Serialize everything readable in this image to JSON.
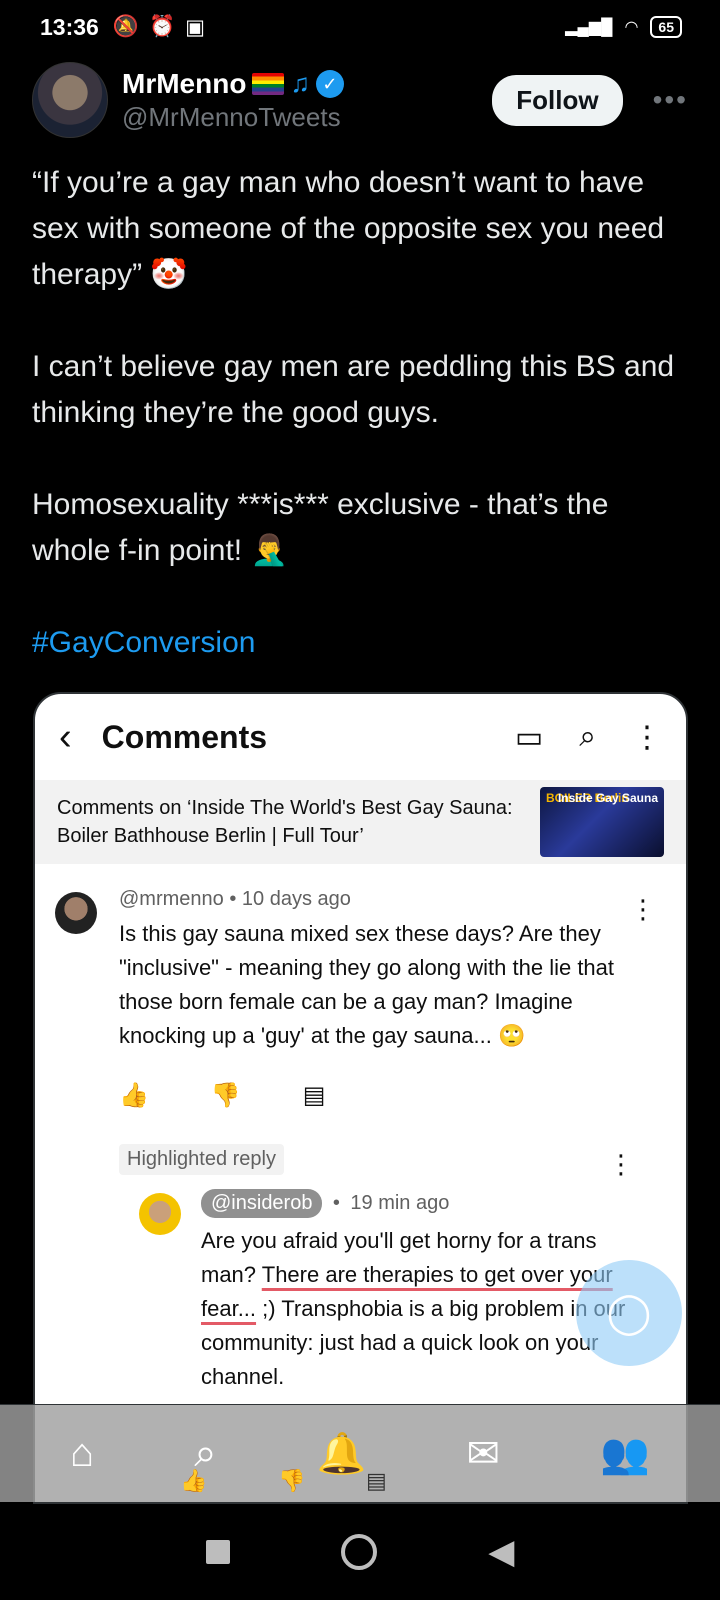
{
  "status_bar": {
    "time": "13:36",
    "left_icons": [
      "mute-bell-icon",
      "alarm-icon",
      "screen-cast-icon"
    ],
    "right_icons": [
      "signal-icon",
      "wifi-icon"
    ],
    "battery": "65"
  },
  "tweet": {
    "display_name": "MrMenno",
    "name_badges": [
      "rainbow-flag-icon",
      "music-notes-icon",
      "verified-badge-icon"
    ],
    "handle": "@MrMennoTweets",
    "follow_label": "Follow",
    "paragraph1": "“If you’re a gay man who doesn’t want to have sex with someone of the opposite sex you need therapy” 🤡",
    "paragraph2": "I can’t believe gay men are peddling this BS and thinking they’re the good guys.",
    "paragraph3": "Homosexuality ***is*** exclusive - that’s the whole f-in point! 🤦‍♂️",
    "hashtag": "#GayConversion"
  },
  "embedded": {
    "header_title": "Comments",
    "video_title": "Comments on ‘Inside The World's Best Gay Sauna: Boiler Bathhouse Berlin | Full Tour’",
    "thumb_text_left": "BOILER Berlin",
    "thumb_text_right": "Inside Gay Sauna",
    "comment": {
      "author": "@mrmenno",
      "time": "10 days ago",
      "text": "Is this gay sauna mixed sex these days? Are they \"inclusive\" - meaning they go along with the lie that those born female can be a gay man? Imagine knocking up a 'guy' at the gay sauna... 🙄"
    },
    "highlight_label": "Highlighted reply",
    "reply": {
      "author": "@insiderob",
      "time": "19 min ago",
      "text_before": "Are you afraid you'll get horny for a trans man? ",
      "text_underlined": "There are therapies to get over your fear...",
      "text_after": " ;) Transphobia is a big problem in our community: just had a quick look on your channel."
    }
  },
  "bottom_nav": [
    "home-icon",
    "search-icon",
    "notifications-icon",
    "messages-icon",
    "communities-icon"
  ]
}
